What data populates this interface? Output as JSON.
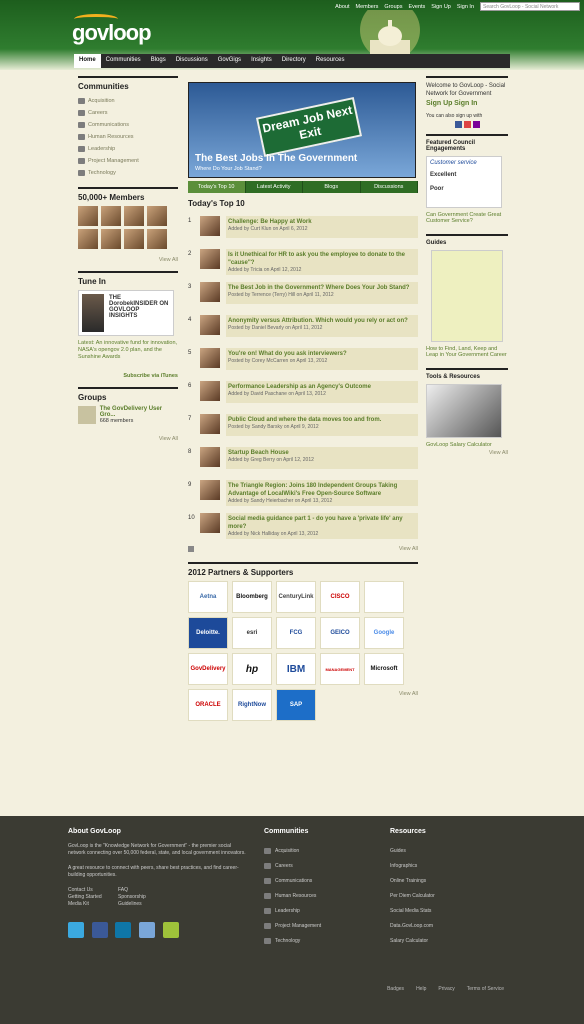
{
  "header": {
    "links": [
      "About",
      "Members",
      "Groups",
      "Events",
      "Sign Up",
      "Sign In"
    ],
    "search_placeholder": "Search GovLoop - Social Network",
    "logo": "govloop"
  },
  "nav": [
    "Home",
    "Communities",
    "Blogs",
    "Discussions",
    "GovGigs",
    "Insights",
    "Directory",
    "Resources"
  ],
  "left": {
    "communities_title": "Communities",
    "communities": [
      "Acquisition",
      "Careers",
      "Communications",
      "Human Resources",
      "Leadership",
      "Project Management",
      "Technology"
    ],
    "members_title": "50,000+ Members",
    "view_all": "View All",
    "tunein_title": "Tune In",
    "tunein_banner": "THE DorobekINSIDER ON GOVLOOP INSIGHTS",
    "tunein_text": "Latest: An innovative fund for innovation, NASA's opengov 2.0 plan, and the Sunshine Awards",
    "subscribe": "Subscribe via iTunes",
    "groups_title": "Groups",
    "group_name": "The GovDelivery User Gro...",
    "group_members": "668 members"
  },
  "middle": {
    "hero_title": "The Best Jobs In The Government",
    "hero_sub": "Where Do Your Job Stand?",
    "hero_sign": "Dream Job Next Exit",
    "tabs": [
      "Today's Top 10",
      "Latest Activity",
      "Blogs",
      "Discussions"
    ],
    "top10_title": "Today's Top 10",
    "items": [
      {
        "n": "1",
        "title": "Challenge: Be Happy at Work",
        "by": "Added by Curt Klun on April 6, 2012"
      },
      {
        "n": "2",
        "title": "Is it Unethical for HR to ask you the employee to donate to the \"cause\"?",
        "by": "Added by Tricia on April 12, 2012"
      },
      {
        "n": "3",
        "title": "The Best Job in the Government? Where Does Your Job Stand?",
        "by": "Posted by Terrence (Terry) Hill on April 11, 2012"
      },
      {
        "n": "4",
        "title": "Anonymity versus Attribution. Which would you rely or act on?",
        "by": "Posted by Daniel Bevarly on April 11, 2012"
      },
      {
        "n": "5",
        "title": "You're on! What do you ask interviewers?",
        "by": "Posted by Corey McCarren on April 13, 2012"
      },
      {
        "n": "6",
        "title": "Performance Leadership as an Agency's Outcome",
        "by": "Added by David Paschane on April 13, 2012"
      },
      {
        "n": "7",
        "title": "Public Cloud and where the data moves too and from.",
        "by": "Posted by Sandy Barsky on April 9, 2012"
      },
      {
        "n": "8",
        "title": "Startup Beach House",
        "by": "Added by Greg Berry on April 12, 2012"
      },
      {
        "n": "9",
        "title": "The Triangle Region: Joins 180 Independent Groups Taking Advantage of LocalWiki's Free Open-Source Software",
        "by": "Added by Sandy Heierbacher on April 13, 2012"
      },
      {
        "n": "10",
        "title": "Social media guidance part 1 - do you have a 'private life' any more?",
        "by": "Added by Nick Halliday on April 13, 2012"
      }
    ],
    "partners_title": "2012 Partners & Supporters",
    "partners": [
      "Aetna",
      "Bloomberg",
      "CenturyLink",
      "CISCO",
      "",
      "Deloitte.",
      "esri",
      "FCG",
      "GEICO",
      "Google",
      "GovDelivery",
      "hp",
      "IBM",
      "MANAGEMENT",
      "Microsoft",
      "ORACLE",
      "RightNow",
      "SAP"
    ]
  },
  "right": {
    "welcome": "Welcome to GovLoop - Social Network for Government",
    "signup": "Sign Up",
    "signin": "Sign In",
    "also": "You can also sign up with",
    "featured_title": "Featured Council Engagements",
    "featured_link": "Can Government Create Great Customer Service?",
    "guides_title": "Guides",
    "guides_link": "How to Find, Land, Keep and Leap in Your Government Career",
    "tools_title": "Tools & Resources",
    "tools_link": "GovLoop Salary Calculator",
    "view_all": "View All",
    "survey": [
      "Customer service",
      "Excellent",
      "Poor"
    ]
  },
  "footer": {
    "about_title": "About GovLoop",
    "about_text": "GovLoop is the \"Knowledge Network for Government\" - the premier social network connecting over 50,000 federal, state, and local government innovators.",
    "about_text2": "A great resource to connect with peers, share best practices, and find career-building opportunities.",
    "links": [
      "Contact Us",
      "FAQ",
      "Getting Started",
      "Sponsorship",
      "Media Kit",
      "Guidelines"
    ],
    "communities_title": "Communities",
    "communities": [
      "Acquisition",
      "Careers",
      "Communications",
      "Human Resources",
      "Leadership",
      "Project Management",
      "Technology"
    ],
    "resources_title": "Resources",
    "resources": [
      "Guides",
      "Infographics",
      "Online Trainings",
      "Per Diem Calculator",
      "Social Media Stats",
      "Data.GovLoop.com",
      "Salary Calculator"
    ],
    "bottom": [
      "Badges",
      "Help",
      "Privacy",
      "Terms of Service"
    ]
  }
}
